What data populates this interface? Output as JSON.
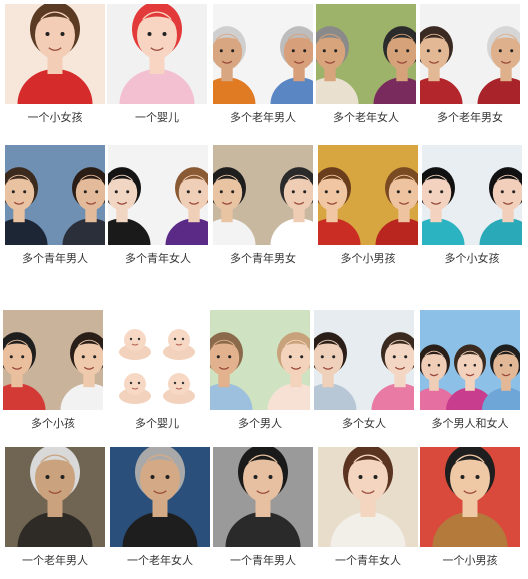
{
  "rows": [
    {
      "cells": [
        {
          "caption": "一个小女孩",
          "subject": "one-little-girl",
          "bg": "#f6e7da",
          "people": [
            {
              "skin": "#f4cdb6",
              "hair": "#5a3a22",
              "shirt": "#d62b2b"
            }
          ]
        },
        {
          "caption": "一个婴儿",
          "subject": "one-baby",
          "bg": "#f1f1f1",
          "people": [
            {
              "skin": "#f7d5c2",
              "hair": "#e23a3a",
              "shirt": "#f2c0d0"
            }
          ]
        },
        {
          "caption": "多个老年男人",
          "subject": "several-elderly-men",
          "bg": "#f4f4f4",
          "people": [
            {
              "skin": "#d9a682",
              "hair": "#cfcfcf",
              "shirt": "#e07a23"
            },
            {
              "skin": "#d7a07a",
              "hair": "#bdbdbd",
              "shirt": "#5b86c4"
            }
          ]
        },
        {
          "caption": "多个老年女人",
          "subject": "several-elderly-women",
          "bg": "#9db36a",
          "people": [
            {
              "skin": "#d8a47c",
              "hair": "#8a8a8a",
              "shirt": "#e9e0cf"
            },
            {
              "skin": "#d5a27a",
              "hair": "#2b2b2b",
              "shirt": "#7a2b5e"
            }
          ]
        },
        {
          "caption": "多个老年男女",
          "subject": "elderly-man-and-woman",
          "bg": "#f2f2f2",
          "people": [
            {
              "skin": "#e3b895",
              "hair": "#3a2a22",
              "shirt": "#b3262b"
            },
            {
              "skin": "#dfb08c",
              "hair": "#d6d6d6",
              "shirt": "#a8242a"
            }
          ]
        }
      ]
    },
    {
      "cells": [
        {
          "caption": "多个青年男人",
          "subject": "several-young-men",
          "bg": "#6f8fb3",
          "people": [
            {
              "skin": "#e9c2a2",
              "hair": "#3b2a1e",
              "shirt": "#1d2635"
            },
            {
              "skin": "#e4bb9a",
              "hair": "#2a1d16",
              "shirt": "#2a2f3a"
            }
          ]
        },
        {
          "caption": "多个青年女人",
          "subject": "several-young-women",
          "bg": "#f3f3f3",
          "people": [
            {
              "skin": "#f2d6c4",
              "hair": "#141414",
              "shirt": "#1a1a1a"
            },
            {
              "skin": "#f0cfb8",
              "hair": "#8a5a35",
              "shirt": "#5b2a86"
            }
          ]
        },
        {
          "caption": "多个青年男女",
          "subject": "young-man-and-woman",
          "bg": "#c9b8a0",
          "people": [
            {
              "skin": "#e9c4a3",
              "hair": "#1e1e1e",
              "shirt": "#f3f3f3"
            },
            {
              "skin": "#efcdb4",
              "hair": "#2a2a2a",
              "shirt": "#ffffff"
            }
          ]
        },
        {
          "caption": "多个小男孩",
          "subject": "several-little-boys",
          "bg": "#d8a640",
          "people": [
            {
              "skin": "#f0c7a2",
              "hair": "#6a3e1d",
              "shirt": "#c92d24"
            },
            {
              "skin": "#eec4a0",
              "hair": "#7a4a22",
              "shirt": "#b8261f"
            }
          ]
        },
        {
          "caption": "多个小女孩",
          "subject": "several-little-girls",
          "bg": "#e9eef2",
          "people": [
            {
              "skin": "#f3d3bf",
              "hair": "#111111",
              "shirt": "#2bb3c2"
            },
            {
              "skin": "#f1cfba",
              "hair": "#111111",
              "shirt": "#2aa9b8"
            }
          ]
        }
      ]
    },
    {
      "cells": [
        {
          "caption": "多个小孩",
          "subject": "several-children",
          "bg": "#c9b39a",
          "people": [
            {
              "skin": "#eabf9d",
              "hair": "#1e1e1e",
              "shirt": "#d43a35"
            },
            {
              "skin": "#efc9ab",
              "hair": "#2a1e18",
              "shirt": "#f2f2f2"
            }
          ]
        },
        {
          "caption": "多个婴儿",
          "subject": "several-babies",
          "bg": "#ffffff",
          "babies": true
        },
        {
          "caption": "多个男人",
          "subject": "man-and-baby",
          "bg": "#cfe3c2",
          "people": [
            {
              "skin": "#e2b18e",
              "hair": "#8a6a4a",
              "shirt": "#9cc0dd"
            },
            {
              "skin": "#f4d3bd",
              "hair": "#c8a27a",
              "shirt": "#f6e1d4"
            }
          ]
        },
        {
          "caption": "多个女人",
          "subject": "woman-and-girl",
          "bg": "#e6ecef",
          "people": [
            {
              "skin": "#efd0bb",
              "hair": "#2b1e18",
              "shirt": "#b8c7d6"
            },
            {
              "skin": "#f3d6c4",
              "hair": "#3a2a20",
              "shirt": "#e87aa3"
            }
          ]
        },
        {
          "caption": "多个男人和女人",
          "subject": "family-group",
          "bg": "#8cc0e6",
          "people": [
            {
              "skin": "#efcdb6",
              "hair": "#2a1e18",
              "shirt": "#e46fa0"
            },
            {
              "skin": "#f2d2bd",
              "hair": "#3a2a20",
              "shirt": "#c83d8e"
            },
            {
              "skin": "#e3b896",
              "hair": "#1e1e1e",
              "shirt": "#6fa6d8"
            }
          ]
        }
      ]
    },
    {
      "cells": [
        {
          "caption": "一个老年男人",
          "subject": "one-elderly-man",
          "bg": "#6f6552",
          "people": [
            {
              "skin": "#caa37e",
              "hair": "#d9d9d9",
              "shirt": "#2e2a26"
            }
          ]
        },
        {
          "caption": "一个老年女人",
          "subject": "one-elderly-woman",
          "bg": "#2a4f7a",
          "people": [
            {
              "skin": "#d4aa86",
              "hair": "#a9a9a9",
              "shirt": "#1e1e1e"
            }
          ]
        },
        {
          "caption": "一个青年男人",
          "subject": "one-young-man",
          "bg": "#9a9a9a",
          "people": [
            {
              "skin": "#e6c0a0",
              "hair": "#1a1a1a",
              "shirt": "#2a2a2a"
            }
          ]
        },
        {
          "caption": "一个青年女人",
          "subject": "one-young-woman",
          "bg": "#e8dccb",
          "people": [
            {
              "skin": "#f3d5c0",
              "hair": "#5a3420",
              "shirt": "#f2efe9"
            }
          ]
        },
        {
          "caption": "一个小男孩",
          "subject": "one-little-boy",
          "bg": "#d94a3c",
          "people": [
            {
              "skin": "#efc8a6",
              "hair": "#1e1e1e",
              "shirt": "#b47a3c"
            }
          ]
        }
      ]
    }
  ]
}
